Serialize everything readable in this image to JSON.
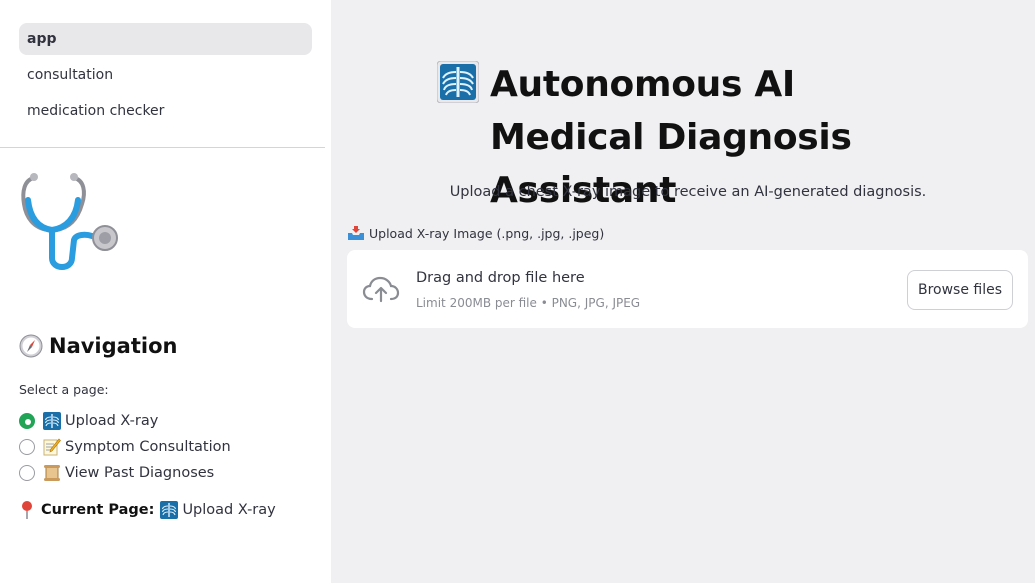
{
  "sidebar": {
    "pages": [
      {
        "label": "app",
        "active": true
      },
      {
        "label": "consultation",
        "active": false
      },
      {
        "label": "medication checker",
        "active": false
      }
    ],
    "logo_icon": "stethoscope-icon",
    "nav_heading": "Navigation",
    "nav_icon": "compass-icon",
    "select_label": "Select a page:",
    "options": [
      {
        "label": "Upload X-ray",
        "icon": "xray-icon",
        "selected": true
      },
      {
        "label": "Symptom Consultation",
        "icon": "memo-icon",
        "selected": false
      },
      {
        "label": "View Past Diagnoses",
        "icon": "scroll-icon",
        "selected": false
      }
    ],
    "current_page_label": "Current Page:",
    "current_page_value": "Upload X-ray"
  },
  "main": {
    "title": "Autonomous AI Medical Diagnosis Assistant",
    "subtitle": "Upload a chest X-ray image to receive an AI-generated diagnosis.",
    "upload_label": "Upload X-ray Image (.png, .jpg, .jpeg)",
    "dropzone": {
      "title": "Drag and drop file here",
      "limit": "Limit 200MB per file • PNG, JPG, JPEG",
      "button": "Browse files"
    }
  },
  "colors": {
    "accent_green": "#21a456",
    "sidebar_bg": "#ffffff",
    "main_bg": "#f0f0f2"
  }
}
